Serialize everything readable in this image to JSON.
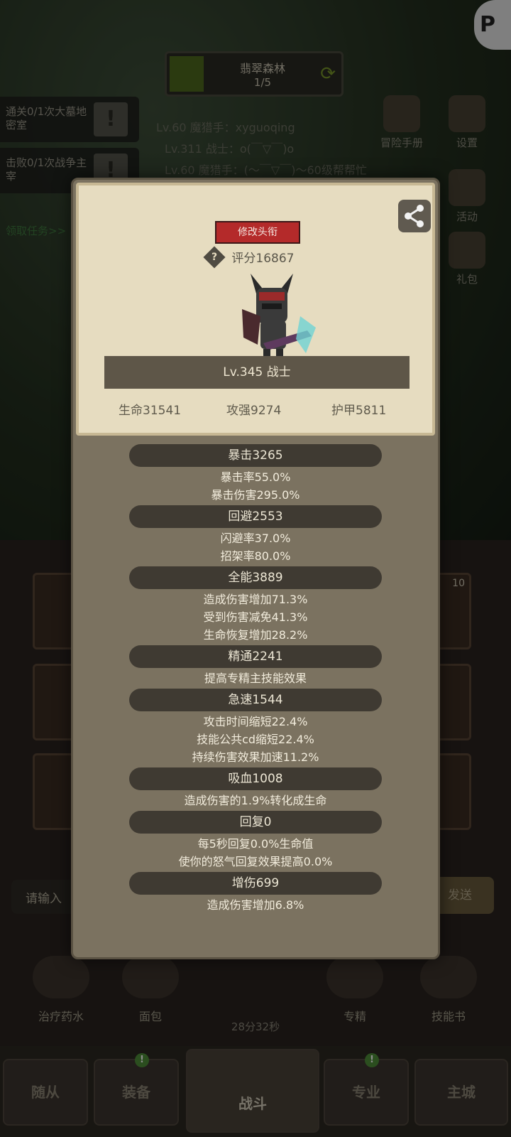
{
  "corner_logo": "P",
  "stage": {
    "name": "翡翠森林",
    "progress": "1/5"
  },
  "quests": [
    {
      "text": "通关0/1次大墓地密室"
    },
    {
      "text": "击败0/1次战争主宰"
    }
  ],
  "claim_quests": "领取任务>>",
  "chat_lines": [
    "Lv.60 魔猎手：xyguoqing",
    "Lv.311 战士：o(￣▽￣)o",
    "Lv.60 魔猎手：(～￣▽￣)～60级帮帮忙"
  ],
  "side_buttons": [
    {
      "label": "冒险手册",
      "icon": "book-icon"
    },
    {
      "label": "设置",
      "icon": "gear-icon"
    },
    {
      "label": "活动",
      "icon": "calendar-icon"
    },
    {
      "label": "礼包",
      "icon": "gift-icon"
    }
  ],
  "slot_count": "10",
  "chat_input": {
    "placeholder": "请输入"
  },
  "send_label": "发送",
  "consumables": [
    {
      "label": "治疗药水",
      "icon": "potion-icon"
    },
    {
      "label": "面包",
      "icon": "bread-icon"
    },
    {
      "label": "专精",
      "icon": "specialization-icon"
    },
    {
      "label": "技能书",
      "icon": "skill-book-icon"
    }
  ],
  "timer": "28分32秒",
  "bottom_nav": [
    {
      "label": "随从",
      "badge": false
    },
    {
      "label": "装备",
      "badge": true
    },
    {
      "label": "战斗",
      "badge": false
    },
    {
      "label": "专业",
      "badge": true
    },
    {
      "label": "主城",
      "badge": false
    }
  ],
  "badge_symbol": "!",
  "profile": {
    "title_button": "修改头衔",
    "help_symbol": "?",
    "score": "评分16867",
    "level_class": "Lv.345 战士",
    "hp": "生命31541",
    "attack": "攻强9274",
    "armor": "护甲5811"
  },
  "stats": [
    {
      "header": "暴击3265",
      "lines": [
        "暴击率55.0%",
        "暴击伤害295.0%"
      ]
    },
    {
      "header": "回避2553",
      "lines": [
        "闪避率37.0%",
        "招架率80.0%"
      ]
    },
    {
      "header": "全能3889",
      "lines": [
        "造成伤害增加71.3%",
        "受到伤害减免41.3%",
        "生命恢复增加28.2%"
      ]
    },
    {
      "header": "精通2241",
      "lines": [
        "提高专精主技能效果"
      ]
    },
    {
      "header": "急速1544",
      "lines": [
        "攻击时间缩短22.4%",
        "技能公共cd缩短22.4%",
        "持续伤害效果加速11.2%"
      ]
    },
    {
      "header": "吸血1008",
      "lines": [
        "造成伤害的1.9%转化成生命"
      ]
    },
    {
      "header": "回复0",
      "lines": [
        "每5秒回复0.0%生命值",
        "使你的怒气回复效果提高0.0%"
      ]
    },
    {
      "header": "增伤699",
      "lines": [
        "造成伤害增加6.8%"
      ]
    }
  ],
  "colors": {
    "title_button": "#b42a2a",
    "panel": "#e6dcc0",
    "modal": "#7b7260",
    "stat_header": "#3f3a32"
  }
}
